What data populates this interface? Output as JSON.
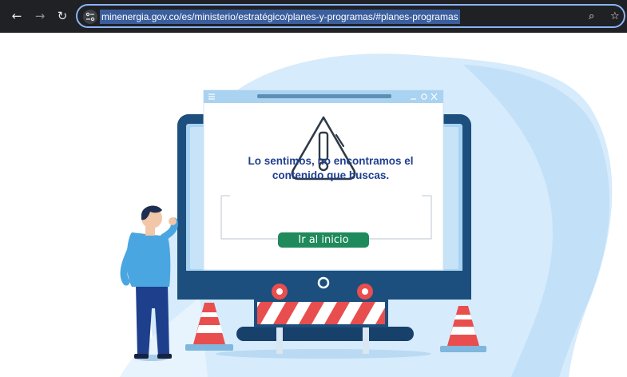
{
  "browser": {
    "url": "minenergia.gov.co/es/ministerio/estratégico/planes-y-programas/#planes-programas",
    "back_icon": "←",
    "forward_icon": "→",
    "reload_icon": "↻",
    "zoom_icon": "⌕",
    "star_icon": "☆"
  },
  "error_page": {
    "message_line1": "Lo sentimos, no encontramos el",
    "message_line2": "contenido que buscas.",
    "home_button": "Ir al inicio"
  },
  "colors": {
    "toolbar": "#202124",
    "omnibox_border": "#8ab4f8",
    "message": "#1f3f8f",
    "button": "#1f8a5b",
    "monitor": "#1c4f7d",
    "background_blob": "#d6ebfb"
  }
}
